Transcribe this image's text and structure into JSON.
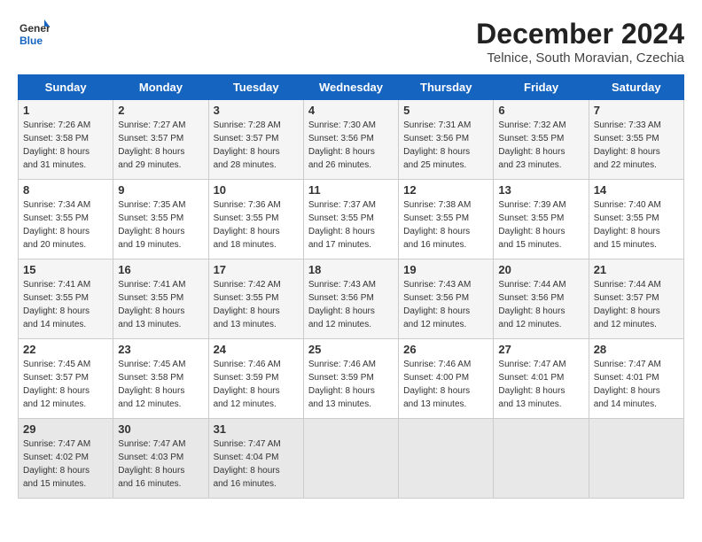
{
  "logo": {
    "line1": "General",
    "line2": "Blue"
  },
  "title": "December 2024",
  "subtitle": "Telnice, South Moravian, Czechia",
  "days_header": [
    "Sunday",
    "Monday",
    "Tuesday",
    "Wednesday",
    "Thursday",
    "Friday",
    "Saturday"
  ],
  "weeks": [
    [
      {
        "day": "1",
        "info": "Sunrise: 7:26 AM\nSunset: 3:58 PM\nDaylight: 8 hours\nand 31 minutes."
      },
      {
        "day": "2",
        "info": "Sunrise: 7:27 AM\nSunset: 3:57 PM\nDaylight: 8 hours\nand 29 minutes."
      },
      {
        "day": "3",
        "info": "Sunrise: 7:28 AM\nSunset: 3:57 PM\nDaylight: 8 hours\nand 28 minutes."
      },
      {
        "day": "4",
        "info": "Sunrise: 7:30 AM\nSunset: 3:56 PM\nDaylight: 8 hours\nand 26 minutes."
      },
      {
        "day": "5",
        "info": "Sunrise: 7:31 AM\nSunset: 3:56 PM\nDaylight: 8 hours\nand 25 minutes."
      },
      {
        "day": "6",
        "info": "Sunrise: 7:32 AM\nSunset: 3:55 PM\nDaylight: 8 hours\nand 23 minutes."
      },
      {
        "day": "7",
        "info": "Sunrise: 7:33 AM\nSunset: 3:55 PM\nDaylight: 8 hours\nand 22 minutes."
      }
    ],
    [
      {
        "day": "8",
        "info": "Sunrise: 7:34 AM\nSunset: 3:55 PM\nDaylight: 8 hours\nand 20 minutes."
      },
      {
        "day": "9",
        "info": "Sunrise: 7:35 AM\nSunset: 3:55 PM\nDaylight: 8 hours\nand 19 minutes."
      },
      {
        "day": "10",
        "info": "Sunrise: 7:36 AM\nSunset: 3:55 PM\nDaylight: 8 hours\nand 18 minutes."
      },
      {
        "day": "11",
        "info": "Sunrise: 7:37 AM\nSunset: 3:55 PM\nDaylight: 8 hours\nand 17 minutes."
      },
      {
        "day": "12",
        "info": "Sunrise: 7:38 AM\nSunset: 3:55 PM\nDaylight: 8 hours\nand 16 minutes."
      },
      {
        "day": "13",
        "info": "Sunrise: 7:39 AM\nSunset: 3:55 PM\nDaylight: 8 hours\nand 15 minutes."
      },
      {
        "day": "14",
        "info": "Sunrise: 7:40 AM\nSunset: 3:55 PM\nDaylight: 8 hours\nand 15 minutes."
      }
    ],
    [
      {
        "day": "15",
        "info": "Sunrise: 7:41 AM\nSunset: 3:55 PM\nDaylight: 8 hours\nand 14 minutes."
      },
      {
        "day": "16",
        "info": "Sunrise: 7:41 AM\nSunset: 3:55 PM\nDaylight: 8 hours\nand 13 minutes."
      },
      {
        "day": "17",
        "info": "Sunrise: 7:42 AM\nSunset: 3:55 PM\nDaylight: 8 hours\nand 13 minutes."
      },
      {
        "day": "18",
        "info": "Sunrise: 7:43 AM\nSunset: 3:56 PM\nDaylight: 8 hours\nand 12 minutes."
      },
      {
        "day": "19",
        "info": "Sunrise: 7:43 AM\nSunset: 3:56 PM\nDaylight: 8 hours\nand 12 minutes."
      },
      {
        "day": "20",
        "info": "Sunrise: 7:44 AM\nSunset: 3:56 PM\nDaylight: 8 hours\nand 12 minutes."
      },
      {
        "day": "21",
        "info": "Sunrise: 7:44 AM\nSunset: 3:57 PM\nDaylight: 8 hours\nand 12 minutes."
      }
    ],
    [
      {
        "day": "22",
        "info": "Sunrise: 7:45 AM\nSunset: 3:57 PM\nDaylight: 8 hours\nand 12 minutes."
      },
      {
        "day": "23",
        "info": "Sunrise: 7:45 AM\nSunset: 3:58 PM\nDaylight: 8 hours\nand 12 minutes."
      },
      {
        "day": "24",
        "info": "Sunrise: 7:46 AM\nSunset: 3:59 PM\nDaylight: 8 hours\nand 12 minutes."
      },
      {
        "day": "25",
        "info": "Sunrise: 7:46 AM\nSunset: 3:59 PM\nDaylight: 8 hours\nand 13 minutes."
      },
      {
        "day": "26",
        "info": "Sunrise: 7:46 AM\nSunset: 4:00 PM\nDaylight: 8 hours\nand 13 minutes."
      },
      {
        "day": "27",
        "info": "Sunrise: 7:47 AM\nSunset: 4:01 PM\nDaylight: 8 hours\nand 13 minutes."
      },
      {
        "day": "28",
        "info": "Sunrise: 7:47 AM\nSunset: 4:01 PM\nDaylight: 8 hours\nand 14 minutes."
      }
    ],
    [
      {
        "day": "29",
        "info": "Sunrise: 7:47 AM\nSunset: 4:02 PM\nDaylight: 8 hours\nand 15 minutes."
      },
      {
        "day": "30",
        "info": "Sunrise: 7:47 AM\nSunset: 4:03 PM\nDaylight: 8 hours\nand 16 minutes."
      },
      {
        "day": "31",
        "info": "Sunrise: 7:47 AM\nSunset: 4:04 PM\nDaylight: 8 hours\nand 16 minutes."
      },
      {
        "day": "",
        "info": ""
      },
      {
        "day": "",
        "info": ""
      },
      {
        "day": "",
        "info": ""
      },
      {
        "day": "",
        "info": ""
      }
    ]
  ]
}
